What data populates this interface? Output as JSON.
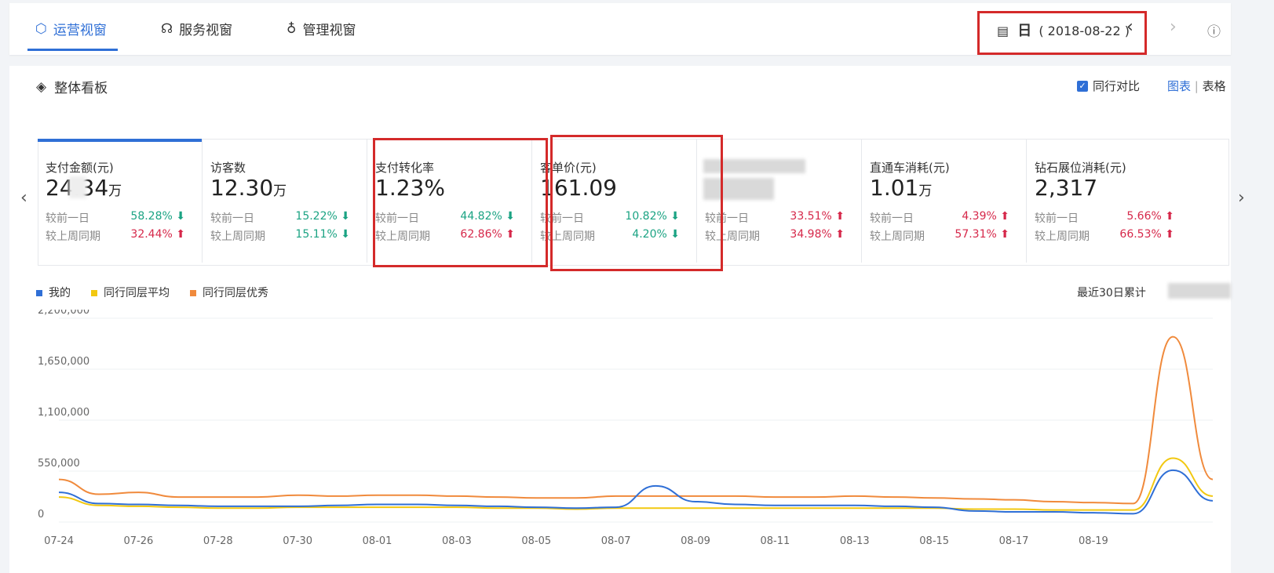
{
  "tabs": [
    {
      "label": "运营视窗",
      "icon": "shield-icon",
      "active": true
    },
    {
      "label": "服务视窗",
      "icon": "headset-icon",
      "active": false
    },
    {
      "label": "管理视窗",
      "icon": "bell-icon",
      "active": false
    }
  ],
  "date": {
    "period": "日",
    "value": "( 2018-08-22 )"
  },
  "section": {
    "title": "整体看板"
  },
  "compare": {
    "label": "同行对比",
    "checked": true
  },
  "view_toggle": {
    "chart": "图表",
    "sep": "|",
    "table": "表格"
  },
  "cards": [
    {
      "name": "支付金额(元)",
      "value": "24.34",
      "unit": "万",
      "r1": "较前一日",
      "p1": "58.28%",
      "d1": "down",
      "r2": "较上周同期",
      "p2": "32.44%",
      "d2": "up"
    },
    {
      "name": "访客数",
      "value": "12.30",
      "unit": "万",
      "r1": "较前一日",
      "p1": "15.22%",
      "d1": "down",
      "r2": "较上周同期",
      "p2": "15.11%",
      "d2": "down"
    },
    {
      "name": "支付转化率",
      "value": "1.23%",
      "unit": "",
      "r1": "较前一日",
      "p1": "44.82%",
      "d1": "down",
      "r2": "较上周同期",
      "p2": "62.86%",
      "d2": "up"
    },
    {
      "name": "客单价(元)",
      "value": "161.09",
      "unit": "",
      "r1": "较前一日",
      "p1": "10.82%",
      "d1": "down",
      "r2": "较上周同期",
      "p2": "4.20%",
      "d2": "down"
    },
    {
      "name": "",
      "value": "",
      "unit": "",
      "r1": "较前一日",
      "p1": "33.51%",
      "d1": "up",
      "r2": "较上周同期",
      "p2": "34.98%",
      "d2": "up"
    },
    {
      "name": "直通车消耗(元)",
      "value": "1.01",
      "unit": "万",
      "r1": "较前一日",
      "p1": "4.39%",
      "d1": "up",
      "r2": "较上周同期",
      "p2": "57.31%",
      "d2": "up"
    },
    {
      "name": "钻石展位消耗(元)",
      "value": "2,317",
      "unit": "",
      "r1": "较前一日",
      "p1": "5.66%",
      "d1": "up",
      "r2": "较上周同期",
      "p2": "66.53%",
      "d2": "up"
    }
  ],
  "legend": {
    "mine": "我的",
    "avg": "同行同层平均",
    "excellent": "同行同层优秀",
    "recent": "最近30日累计"
  },
  "colors": {
    "accent": "#2f6fd6",
    "mine": "#2f6fd6",
    "avg": "#f2c811",
    "excellent": "#f08a3c",
    "up": "#d6284a",
    "down": "#1ba383",
    "highlight": "#d42a2a"
  },
  "chart_data": {
    "type": "line",
    "x": [
      "07-24",
      "07-25",
      "07-26",
      "07-27",
      "07-28",
      "07-29",
      "07-30",
      "07-31",
      "08-01",
      "08-02",
      "08-03",
      "08-04",
      "08-05",
      "08-06",
      "08-07",
      "08-08",
      "08-09",
      "08-10",
      "08-11",
      "08-12",
      "08-13",
      "08-14",
      "08-15",
      "08-16",
      "08-17",
      "08-18",
      "08-19",
      "08-20",
      "08-21",
      "08-22"
    ],
    "xticks": [
      "07-24",
      "07-26",
      "07-28",
      "07-30",
      "08-01",
      "08-03",
      "08-05",
      "08-07",
      "08-09",
      "08-11",
      "08-13",
      "08-15",
      "08-17",
      "08-19"
    ],
    "yticks": [
      "0",
      "550,000",
      "1,100,000",
      "1,650,000",
      "2,200,000"
    ],
    "ylim": [
      0,
      2200000
    ],
    "series": [
      {
        "name": "我的",
        "values": [
          320000,
          200000,
          190000,
          180000,
          170000,
          170000,
          170000,
          180000,
          190000,
          190000,
          180000,
          170000,
          160000,
          150000,
          160000,
          390000,
          220000,
          190000,
          180000,
          180000,
          180000,
          170000,
          160000,
          120000,
          110000,
          110000,
          100000,
          90000,
          560000,
          230000
        ]
      },
      {
        "name": "同行同层平均",
        "values": [
          270000,
          180000,
          170000,
          160000,
          150000,
          150000,
          160000,
          160000,
          160000,
          160000,
          160000,
          150000,
          150000,
          140000,
          150000,
          150000,
          150000,
          150000,
          150000,
          150000,
          150000,
          150000,
          150000,
          140000,
          140000,
          130000,
          130000,
          130000,
          690000,
          280000
        ]
      },
      {
        "name": "同行同层优秀",
        "values": [
          460000,
          300000,
          320000,
          270000,
          270000,
          270000,
          290000,
          280000,
          290000,
          290000,
          280000,
          270000,
          260000,
          260000,
          280000,
          280000,
          280000,
          280000,
          270000,
          270000,
          280000,
          270000,
          260000,
          250000,
          240000,
          220000,
          210000,
          200000,
          2000000,
          460000
        ]
      }
    ]
  }
}
